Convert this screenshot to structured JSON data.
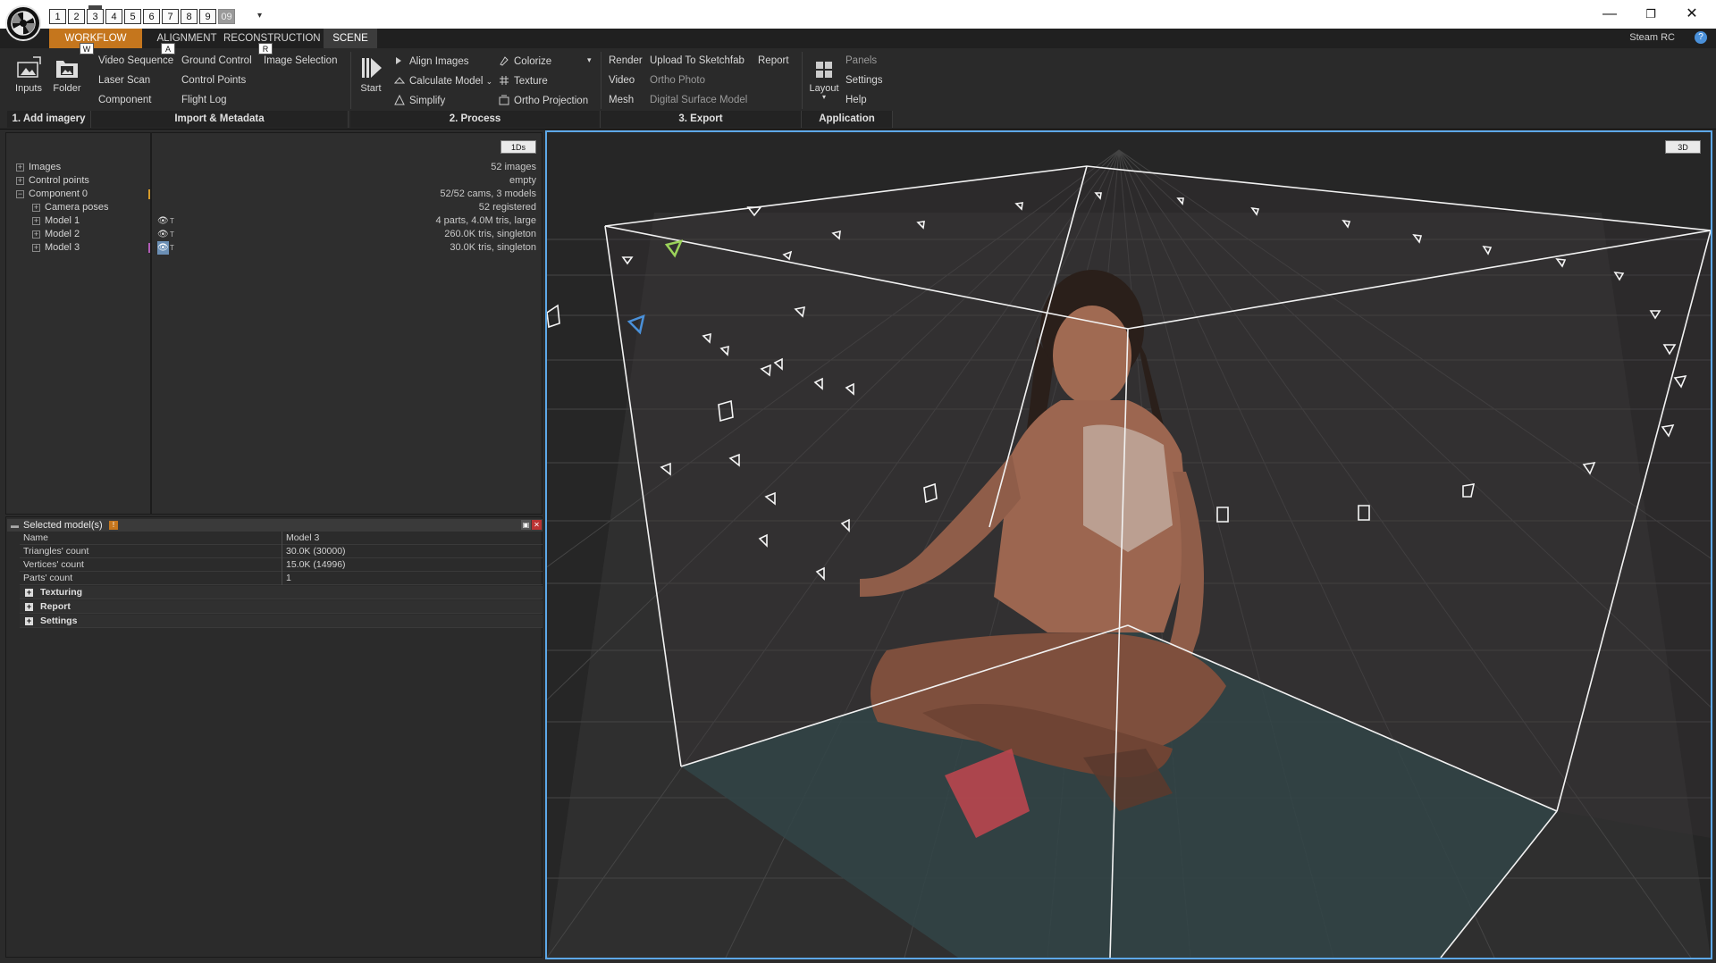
{
  "titlebar": {
    "layout_tabs": [
      "1",
      "2",
      "3",
      "4",
      "5",
      "6",
      "7",
      "8",
      "9",
      "09"
    ],
    "active_layout_tab": "3",
    "window_controls": [
      "minimize-icon",
      "restore-icon",
      "close-icon"
    ]
  },
  "menu": {
    "tabs": [
      "WORKFLOW",
      "ALIGNMENT",
      "RECONSTRUCTION",
      "SCENE"
    ],
    "active_tab": "WORKFLOW",
    "highlighted_tab": "SCENE",
    "key_hints": [
      "W",
      "A",
      "R"
    ],
    "right_label": "Steam RC"
  },
  "ribbon": {
    "add_imagery": {
      "inputs_label": "Inputs",
      "folder_label": "Folder",
      "group_label": "1. Add imagery"
    },
    "import": {
      "items": [
        "Video Sequence",
        "Ground Control",
        "Image Selection",
        "Laser Scan",
        "Control Points",
        "Component",
        "Flight Log"
      ],
      "group_label": "Import & Metadata"
    },
    "process": {
      "start_label": "Start",
      "items": [
        "Align Images",
        "Calculate Model",
        "Simplify",
        "Colorize",
        "Texture",
        "Ortho Projection"
      ],
      "group_label": "2. Process"
    },
    "export": {
      "items": [
        "Render",
        "Upload To Sketchfab",
        "Report",
        "Video",
        "Ortho Photo",
        "Mesh",
        "Digital Surface Model"
      ],
      "group_label": "3. Export"
    },
    "application": {
      "layout_label": "Layout",
      "items": [
        "Panels",
        "Settings",
        "Help"
      ],
      "group_label": "Application"
    }
  },
  "tree": {
    "ids_button": "1Ds",
    "rows": [
      {
        "label": "Images",
        "info": "52 images"
      },
      {
        "label": "Control points",
        "info": "empty"
      },
      {
        "label": "Component 0",
        "info": "52/52 cams, 3 models"
      },
      {
        "label": "Camera poses",
        "info": "52 registered"
      },
      {
        "label": "Model 1",
        "info": "4 parts, 4.0M tris, large"
      },
      {
        "label": "Model 2",
        "info": "260.0K tris, singleton"
      },
      {
        "label": "Model 3",
        "info": "30.0K tris, singleton"
      }
    ]
  },
  "properties": {
    "title": "Selected model(s)",
    "rows": [
      {
        "key": "Name",
        "value": "Model 3"
      },
      {
        "key": "Triangles' count",
        "value": "30.0K (30000)"
      },
      {
        "key": "Vertices' count",
        "value": "15.0K (14996)"
      },
      {
        "key": "Parts' count",
        "value": "1"
      }
    ],
    "sections": [
      "Texturing",
      "Report",
      "Settings"
    ]
  },
  "viewport": {
    "mode_badge": "3D",
    "colors": {
      "selection_border": "#5da8e8",
      "accent": "#c5761d",
      "camera_highlight_green": "#9bd35a",
      "camera_highlight_blue": "#4a90d9",
      "floor_patch": "#c2474f"
    }
  }
}
